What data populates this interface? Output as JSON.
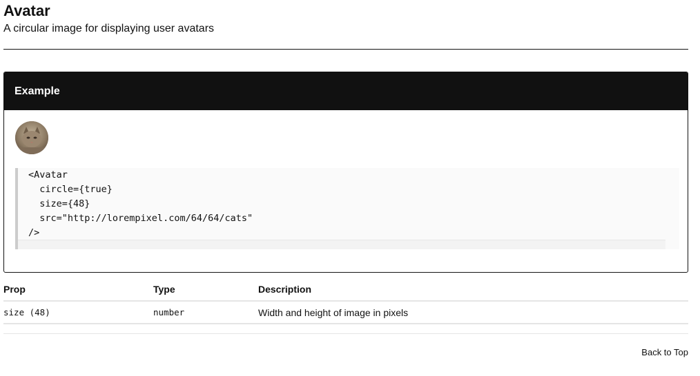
{
  "page": {
    "title": "Avatar",
    "subtitle": "A circular image for displaying user avatars"
  },
  "example": {
    "header": "Example",
    "avatar_alt": "cat-avatar",
    "code": "<Avatar\n  circle={true}\n  size={48}\n  src=\"http://lorempixel.com/64/64/cats\"\n/>"
  },
  "props": {
    "headers": [
      "Prop",
      "Type",
      "Description"
    ],
    "rows": [
      {
        "prop": "size (48)",
        "type": "number",
        "description": "Width and height of image in pixels"
      }
    ]
  },
  "footer": {
    "back_to_top": "Back to Top"
  }
}
